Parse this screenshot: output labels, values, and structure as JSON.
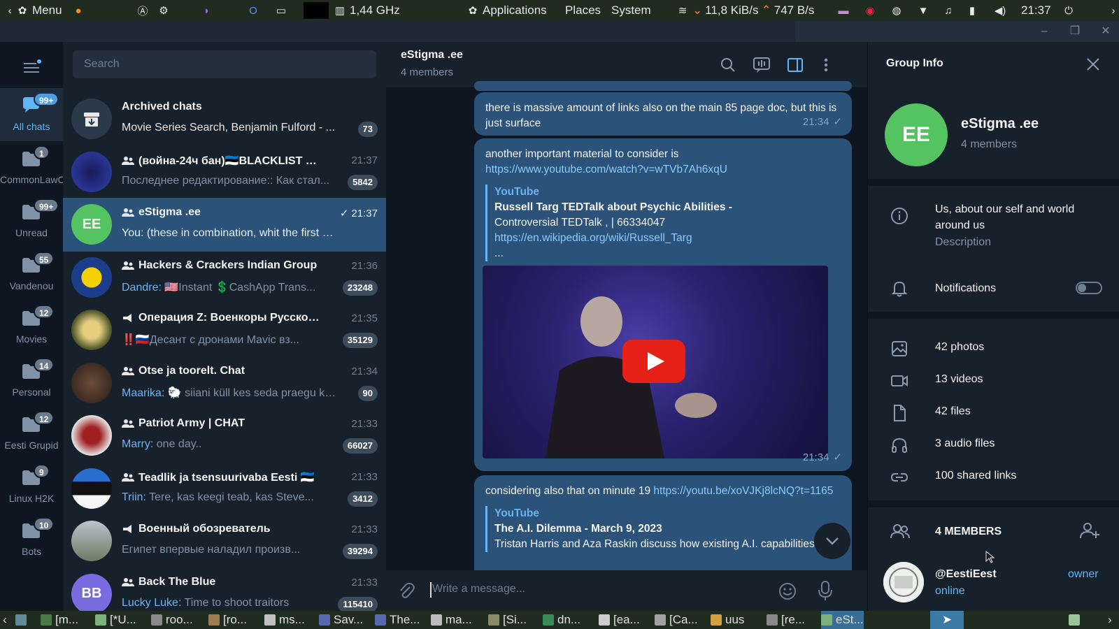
{
  "system": {
    "menu_label": "Menu",
    "cpu": "1,44 GHz",
    "applications": "Applications",
    "places": "Places",
    "system": "System",
    "net_down": "11,8 KiB/s",
    "net_up": "747 B/s",
    "clock": "21:37"
  },
  "folders": [
    {
      "label": "All chats",
      "badge": "99+",
      "active": true
    },
    {
      "label": "CommonLawCLC",
      "badge": "1"
    },
    {
      "label": "Unread",
      "badge": "99+"
    },
    {
      "label": "Vandenou",
      "badge": "55"
    },
    {
      "label": "Movies",
      "badge": "12"
    },
    {
      "label": "Personal",
      "badge": "14"
    },
    {
      "label": "Eesti Grupid",
      "badge": "12"
    },
    {
      "label": "Linux H2K",
      "badge": "9"
    },
    {
      "label": "Bots",
      "badge": "10"
    }
  ],
  "search": {
    "placeholder": "Search"
  },
  "chats": [
    {
      "name": "Archived chats",
      "preview": "Movie Series Search, Benjamin Fulford - ...",
      "badge": "73",
      "time": ""
    },
    {
      "name": "(война-24ч бан)🇪🇪BLACKLIST CHAT...",
      "time": "21:37",
      "preview": "Последнее редактирование:: Как стал...",
      "badge": "5842"
    },
    {
      "name": "eStigma .ee",
      "time": "21:37",
      "preview": "You: (these in combination, whit the first questi...",
      "badge": "",
      "avatar_text": "EE"
    },
    {
      "name": "Hackers & Crackers Indian Group",
      "time": "21:36",
      "sender": "Dandre:",
      "preview": "🇺🇸Instant 💲CashApp Trans...",
      "badge": "23248"
    },
    {
      "name": "Операция Z: Военкоры Русской Ве...",
      "time": "21:35",
      "preview": "‼️🇷🇺Десант с дронами Mavic вз...",
      "badge": "35129"
    },
    {
      "name": "Otse ja toorelt. Chat",
      "time": "21:34",
      "sender": "Maarika:",
      "preview": "🐑 siiani küll kes seda praegu ka...",
      "badge": "90"
    },
    {
      "name": "Patriot Army | CHAT",
      "time": "21:33",
      "sender": "Marry:",
      "preview": "one day..",
      "badge": "66027"
    },
    {
      "name": "Teadlik ja tsensuurivaba Eesti 🇪🇪",
      "time": "21:33",
      "sender": "Triin:",
      "preview": "Tere, kas keegi teab, kas Steve...",
      "badge": "3412"
    },
    {
      "name": "Военный обозреватель",
      "time": "21:33",
      "preview": "Египет впервые наладил произв...",
      "badge": "39294"
    },
    {
      "name": "Back The Blue",
      "time": "21:33",
      "sender": "Lucky Luke:",
      "preview": "Time to shoot traitors",
      "badge": "115410",
      "avatar_text": "BB"
    }
  ],
  "chat_header": {
    "title": "eStigma .ee",
    "subtitle": "4 members"
  },
  "messages": [
    {
      "text": "there is massive amount of links also on the main 85 page doc, but this is just surface",
      "time": "21:34"
    },
    {
      "text": "another important material to consider is",
      "link": "https://www.youtube.com/watch?v=wTVb7Ah6xqU",
      "site": "YouTube",
      "ptitle": "Russell Targ TEDTalk about Psychic Abilities -",
      "pdesc": "Controversial TEDTalk ,  |   66334047",
      "plink": "https://en.wikipedia.org/wiki/Russell_Targ",
      "pmore": "...",
      "time": "21:34"
    },
    {
      "text": "considering also that on minute 19",
      "link": "https://youtu.be/xoVJKj8lcNQ?t=1165",
      "site": "YouTube",
      "ptitle": "The A.I. Dilemma - March 9, 2023",
      "pdesc": "Tristan Harris and Aza Raskin discuss how existing A.I. capabilities"
    }
  ],
  "composer": {
    "placeholder": "Write a message..."
  },
  "group_info": {
    "header": "Group Info",
    "avatar_text": "EE",
    "name": "eStigma .ee",
    "members_count": "4 members",
    "description": "Us, about our self and world around us",
    "description_label": "Description",
    "notifications_label": "Notifications",
    "notifications_on": false,
    "media": [
      "42 photos",
      "13 videos",
      "42 files",
      "3 audio files",
      "100 shared links"
    ],
    "members_header": "4 MEMBERS",
    "member_name": "@EestiEest",
    "member_status": "online",
    "member_role": "owner"
  },
  "taskbar": [
    "[m...",
    "[*U...",
    "roo...",
    "[ro...",
    "ms...",
    "Sav...",
    "The...",
    "ma...",
    "[Si...",
    "dn...",
    "[ea...",
    "[Ca...",
    "uus",
    "[re...",
    "eSt..."
  ],
  "colors": {
    "accent": "#5eb5f7",
    "active_chat": "#2b5278",
    "outgoing_bubble": "#2b5278",
    "group_avatar": "#54c362",
    "bg": "#17212b"
  }
}
